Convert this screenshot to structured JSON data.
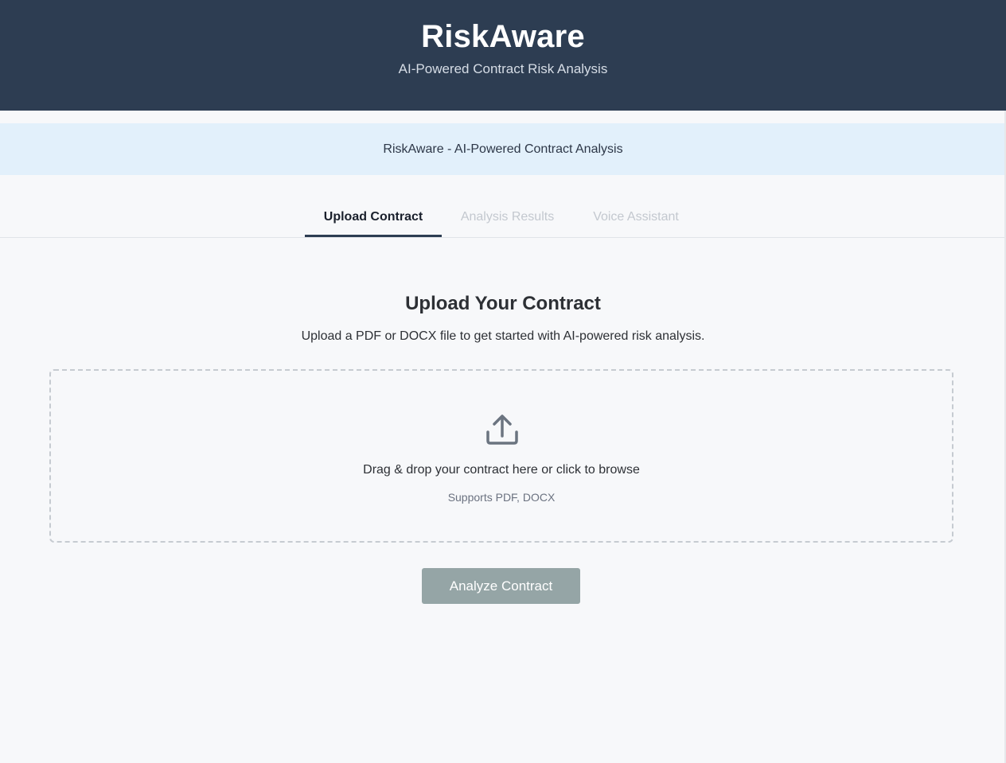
{
  "header": {
    "title": "RiskAware",
    "subtitle": "AI-Powered Contract Risk Analysis"
  },
  "banner": {
    "text": "RiskAware - AI-Powered Contract Analysis"
  },
  "tabs": [
    {
      "label": "Upload Contract",
      "active": true
    },
    {
      "label": "Analysis Results",
      "active": false
    },
    {
      "label": "Voice Assistant",
      "active": false
    }
  ],
  "upload": {
    "title": "Upload Your Contract",
    "description": "Upload a PDF or DOCX file to get started with AI-powered risk analysis.",
    "dropzone_icon": "upload-icon",
    "dropzone_text": "Drag & drop your contract here or click to browse",
    "dropzone_hint": "Supports PDF, DOCX",
    "analyze_label": "Analyze Contract"
  },
  "colors": {
    "header_bg": "#2d3d52",
    "banner_bg": "#e2f0fb",
    "page_bg": "#f7f8fa",
    "active_tab_underline": "#2d3d52",
    "button_disabled": "#95a5a6"
  }
}
